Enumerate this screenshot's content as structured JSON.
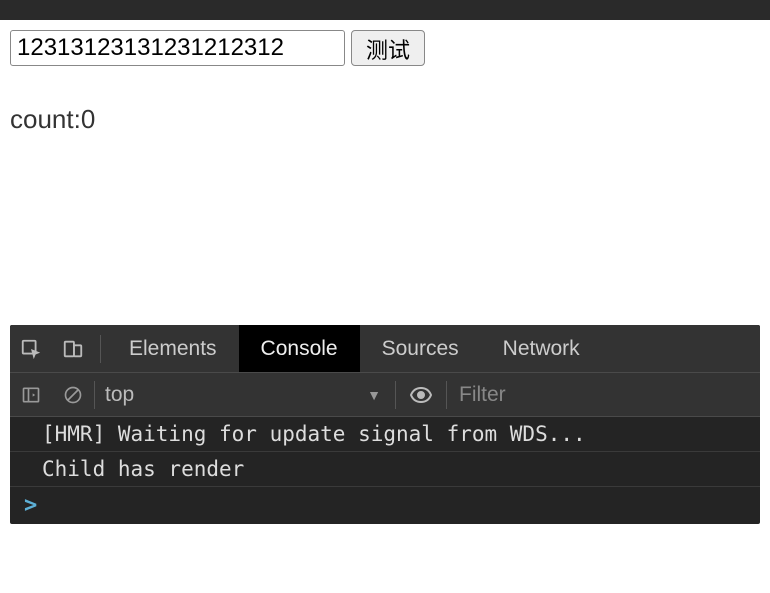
{
  "page": {
    "input_value": "12313123131231212312",
    "button_label": "测试",
    "count_label": "count:0"
  },
  "devtools": {
    "tabs": {
      "elements": "Elements",
      "console": "Console",
      "sources": "Sources",
      "network": "Network"
    },
    "toolbar": {
      "context": "top",
      "filter_placeholder": "Filter"
    },
    "console": {
      "line1": "[HMR] Waiting for update signal from WDS...",
      "line2": "Child has render",
      "prompt": ">"
    }
  }
}
